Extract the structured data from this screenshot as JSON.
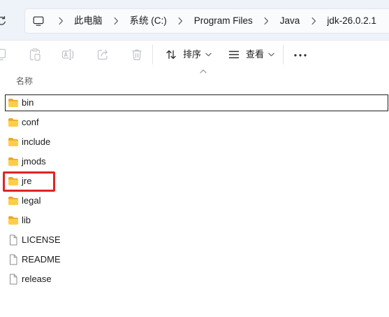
{
  "address_bar": {
    "refresh_icon": "refresh-icon",
    "root_icon": "computer-icon",
    "separator_icon": "chevron-right-icon",
    "breadcrumb": [
      "此电脑",
      "系统 (C:)",
      "Program Files",
      "Java",
      "jdk-26.0.2.1"
    ]
  },
  "toolbar": {
    "actions": [
      {
        "icon": "copy-icon",
        "enabled": false
      },
      {
        "icon": "paste-icon",
        "enabled": false
      },
      {
        "icon": "rename-icon",
        "enabled": false
      },
      {
        "icon": "share-icon",
        "enabled": false
      },
      {
        "icon": "delete-icon",
        "enabled": false
      }
    ],
    "sort": {
      "icon": "sort-icon",
      "label": "排序",
      "dropdown_icon": "chevron-down-icon"
    },
    "view": {
      "icon": "view-icon",
      "label": "查看",
      "dropdown_icon": "chevron-down-icon"
    },
    "more_icon": "more-icon"
  },
  "file_list": {
    "column_header": "名称",
    "sort_indicator_icon": "sort-ascending-icon",
    "items": [
      {
        "name": "bin",
        "icon": "folder-icon",
        "focused": true
      },
      {
        "name": "conf",
        "icon": "folder-icon"
      },
      {
        "name": "include",
        "icon": "folder-icon"
      },
      {
        "name": "jmods",
        "icon": "folder-icon"
      },
      {
        "name": "jre",
        "icon": "folder-icon",
        "highlighted": true
      },
      {
        "name": "legal",
        "icon": "folder-icon"
      },
      {
        "name": "lib",
        "icon": "folder-icon"
      },
      {
        "name": "LICENSE",
        "icon": "file-icon"
      },
      {
        "name": "README",
        "icon": "file-icon"
      },
      {
        "name": "release",
        "icon": "file-icon"
      }
    ]
  },
  "colors": {
    "header_background": "#eef3f9",
    "address_box_background": "#f9fbfd",
    "text": "#1a1a1a",
    "secondary_text": "#5c5c5c",
    "disabled_icon": "#bfc3c8",
    "folder_back": "#e9a825",
    "folder_front": "#ffcd4a",
    "file_outline": "#8c8c8c",
    "focus_border": "#1f1f1f",
    "annotation_box": "#e02424"
  }
}
